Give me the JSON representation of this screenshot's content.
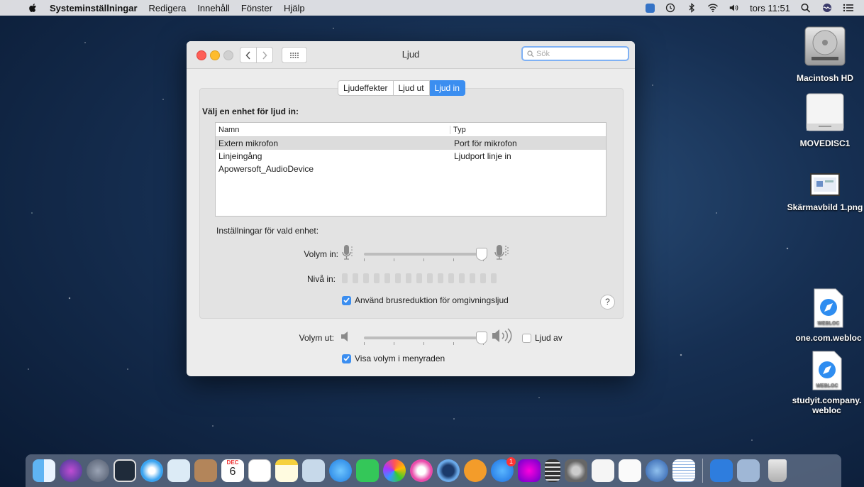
{
  "menubar": {
    "app_name": "Systeminställningar",
    "menus": [
      "Redigera",
      "Innehåll",
      "Fönster",
      "Hjälp"
    ],
    "clock": "tors 11:51",
    "status_icons": [
      "teamviewer-icon",
      "time-machine-icon",
      "bluetooth-icon",
      "wifi-icon",
      "volume-icon"
    ]
  },
  "window": {
    "title": "Ljud",
    "search_placeholder": "Sök",
    "tabs": [
      {
        "label": "Ljudeffekter",
        "active": false
      },
      {
        "label": "Ljud ut",
        "active": false
      },
      {
        "label": "Ljud in",
        "active": true
      }
    ],
    "input": {
      "heading": "Välj en enhet för ljud in:",
      "columns": [
        "Namn",
        "Typ"
      ],
      "rows": [
        {
          "name": "Extern mikrofon",
          "type": "Port för mikrofon",
          "selected": true
        },
        {
          "name": "Linjeingång",
          "type": "Ljudport linje in",
          "selected": false
        },
        {
          "name": "Apowersoft_AudioDevice",
          "type": "",
          "selected": false
        }
      ],
      "settings_label": "Inställningar för vald enhet:",
      "volume_in_label": "Volym in:",
      "volume_in_level": 0.97,
      "level_in_label": "Nivå in:",
      "level_in_segments": 15,
      "noise_reduction_label": "Använd brusreduktion för omgivningsljud",
      "noise_reduction_checked": true
    },
    "output": {
      "volume_out_label": "Volym ut:",
      "volume_out_level": 0.97,
      "mute_label": "Ljud av",
      "mute_checked": false,
      "show_in_menubar_label": "Visa volym i menyraden",
      "show_in_menubar_checked": true
    },
    "help": "?"
  },
  "desktop_icons": [
    {
      "label": "Macintosh HD"
    },
    {
      "label": "MOVEDISC1"
    },
    {
      "label": "Skärmavbild 1.png"
    },
    {
      "label": "one.com.webloc",
      "badge": "WEBLOC"
    },
    {
      "label": "studyit.company.webloc",
      "badge": "WEBLOC"
    }
  ],
  "dock": {
    "calendar_month": "DEC",
    "calendar_day": "6",
    "appstore_badge": "1"
  },
  "colors": {
    "accent": "#3b8ef0",
    "close": "#fe5f57",
    "minimize": "#febc2e"
  }
}
